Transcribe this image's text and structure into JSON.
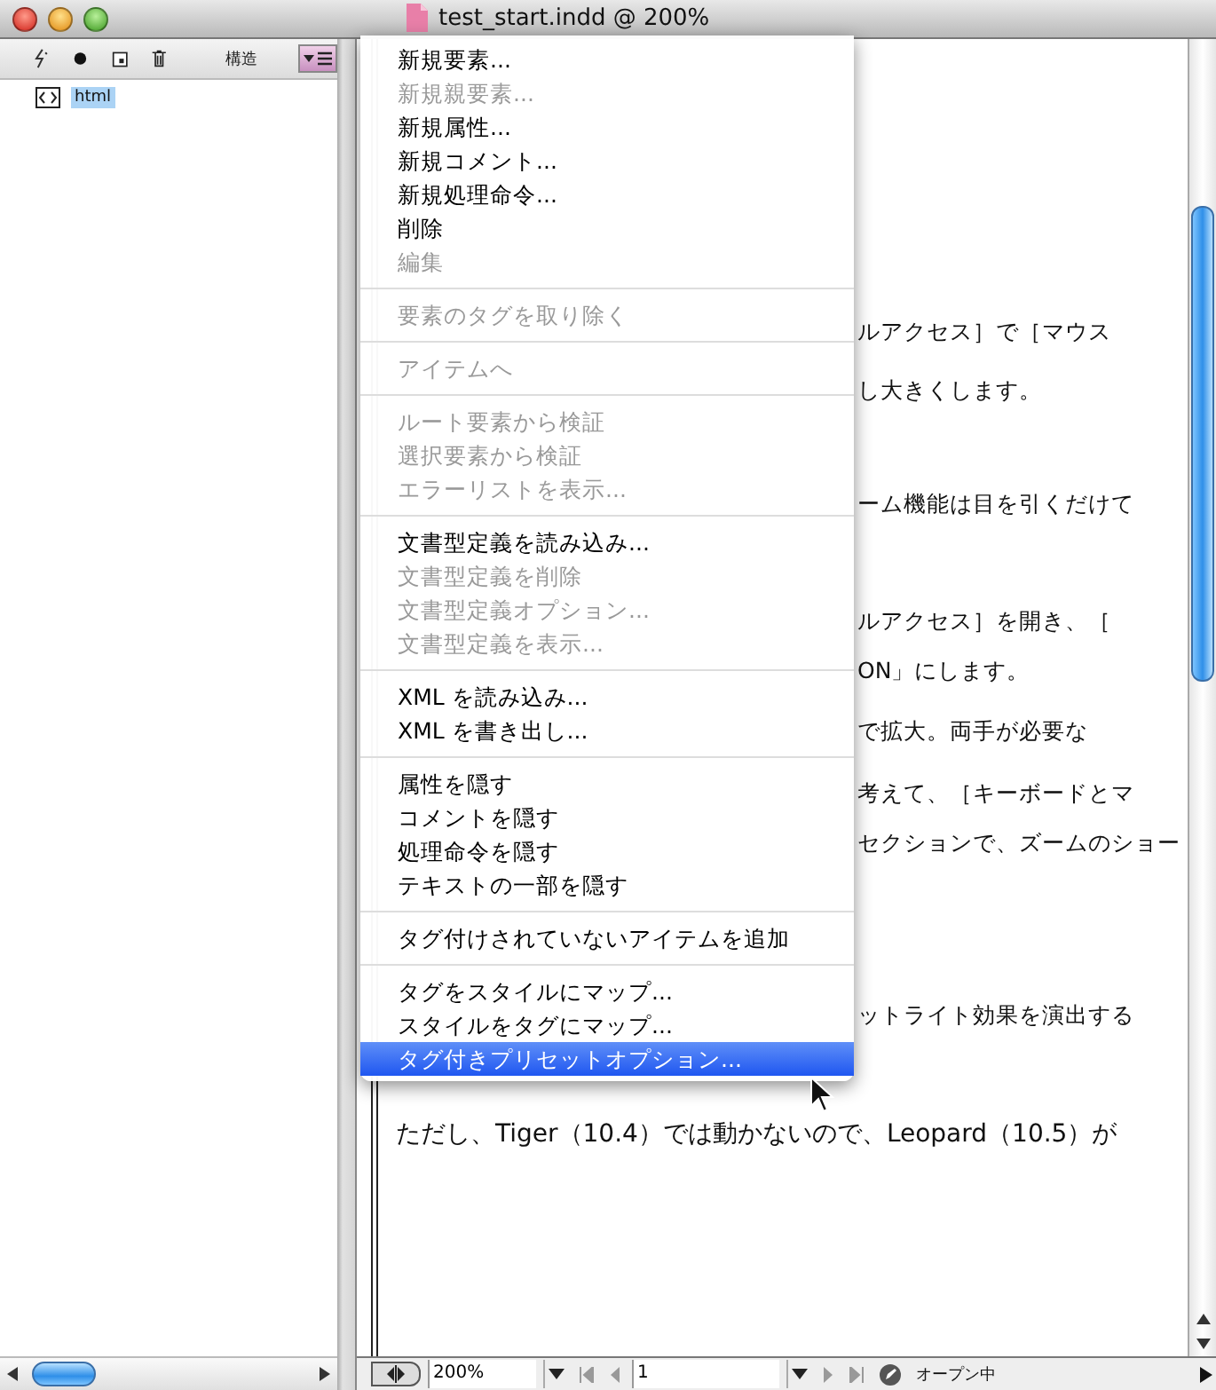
{
  "window": {
    "title": "test_start.indd @ 200%"
  },
  "structure_panel": {
    "title": "構造",
    "tree": [
      {
        "label": "html",
        "selected": true
      }
    ]
  },
  "context_menu": {
    "groups": [
      [
        {
          "label": "新規要素...",
          "disabled": false,
          "selected": false
        },
        {
          "label": "新規親要素...",
          "disabled": true,
          "selected": false
        },
        {
          "label": "新規属性...",
          "disabled": false,
          "selected": false
        },
        {
          "label": "新規コメント...",
          "disabled": false,
          "selected": false
        },
        {
          "label": "新規処理命令...",
          "disabled": false,
          "selected": false
        },
        {
          "label": "削除",
          "disabled": false,
          "selected": false
        },
        {
          "label": "編集",
          "disabled": true,
          "selected": false
        }
      ],
      [
        {
          "label": "要素のタグを取り除く",
          "disabled": true,
          "selected": false
        }
      ],
      [
        {
          "label": "アイテムへ",
          "disabled": true,
          "selected": false
        }
      ],
      [
        {
          "label": "ルート要素から検証",
          "disabled": true,
          "selected": false
        },
        {
          "label": "選択要素から検証",
          "disabled": true,
          "selected": false
        },
        {
          "label": "エラーリストを表示...",
          "disabled": true,
          "selected": false
        }
      ],
      [
        {
          "label": "文書型定義を読み込み...",
          "disabled": false,
          "selected": false
        },
        {
          "label": "文書型定義を削除",
          "disabled": true,
          "selected": false
        },
        {
          "label": "文書型定義オプション...",
          "disabled": true,
          "selected": false
        },
        {
          "label": "文書型定義を表示...",
          "disabled": true,
          "selected": false
        }
      ],
      [
        {
          "label": "XML を読み込み...",
          "disabled": false,
          "selected": false
        },
        {
          "label": "XML を書き出し...",
          "disabled": false,
          "selected": false
        }
      ],
      [
        {
          "label": "属性を隠す",
          "disabled": false,
          "selected": false
        },
        {
          "label": "コメントを隠す",
          "disabled": false,
          "selected": false
        },
        {
          "label": "処理命令を隠す",
          "disabled": false,
          "selected": false
        },
        {
          "label": "テキストの一部を隠す",
          "disabled": false,
          "selected": false
        }
      ],
      [
        {
          "label": "タグ付けされていないアイテムを追加",
          "disabled": false,
          "selected": false
        }
      ],
      [
        {
          "label": "タグをスタイルにマップ...",
          "disabled": false,
          "selected": false
        },
        {
          "label": "スタイルをタグにマップ...",
          "disabled": false,
          "selected": false
        },
        {
          "label": "タグ付きプリセットオプション...",
          "disabled": false,
          "selected": true
        }
      ]
    ]
  },
  "document": {
    "lines": [
      "ルアクセス］で［マウス",
      "し大きくします。",
      "ーム機能は目を引くだけて",
      "ルアクセス］を開き、［",
      "ON」にします。",
      "で拡大。両手が必要な",
      "考えて、［キーボードとマ",
      "セクションで、ズームのショー",
      "ットライト効果を演出する",
      "ただし、Tiger（10.4）では動かないので、Leopard（10.5）が"
    ]
  },
  "status_bar": {
    "zoom": "200%",
    "page": "1",
    "status": "オープン中"
  }
}
